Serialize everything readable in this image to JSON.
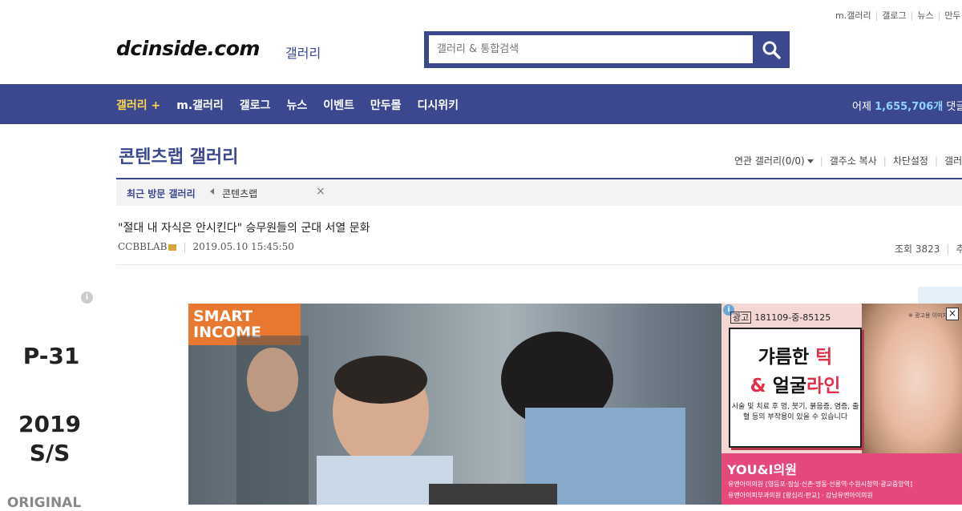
{
  "header": {
    "top_links": [
      "m.갤러리",
      "갤로그",
      "뉴스",
      "만두"
    ],
    "logo": "dcinside.com",
    "logo_sub": "갤러리",
    "search_placeholder": "갤러리 & 통합검색"
  },
  "nav": {
    "items": [
      "갤러리 +",
      "m.갤러리",
      "갤로그",
      "뉴스",
      "이벤트",
      "만두몰",
      "디시위키"
    ],
    "stats_label": "어제",
    "stats_value": "1,655,706개",
    "stats_suffix": "댓글"
  },
  "gallery": {
    "title": "콘텐츠랩 갤러리",
    "links": [
      "연관 갤러리(0/0)",
      "갤주소 복사",
      "차단설정",
      "갤러"
    ]
  },
  "recent": {
    "label": "최근 방문 갤러리",
    "item": "콘텐츠랩",
    "close": "×"
  },
  "post": {
    "title": "\"절대 내 자식은 안시킨다\" 승무원들의 군대 서열 문화",
    "author": "CCBBLAB",
    "date": "2019.05.10 15:45:50",
    "views_label": "조회 3823",
    "rec_label": "추"
  },
  "side_ad": {
    "code": "P-31",
    "season": "2019 S/S",
    "orig": "ORIGINAL"
  },
  "photo": {
    "badge_line1": "SMART",
    "badge_line2": "INCOME"
  },
  "ad": {
    "tag": "광고",
    "permit": "181109-중-85125",
    "note": "※ 광고용 이미지",
    "close": "×",
    "headline1": "갸름한 ",
    "headline1_red": "턱",
    "headline2_red1": "& ",
    "headline2": "얼굴",
    "headline2_red2": "라인",
    "desc": "시술 및 치료 후 멍, 붓기, 붉음증, 염증, 출혈 등의 부작용이 있을 수 있습니다",
    "brand": "YOU&I의원",
    "line1": "유앤아이의원 [영등포·잠실·신촌·명동·선릉역·수원시청역·광교중앙역]",
    "line2": "유앤아이피부과의원 [왕십리·판교] · 강남유앤아이의원"
  }
}
